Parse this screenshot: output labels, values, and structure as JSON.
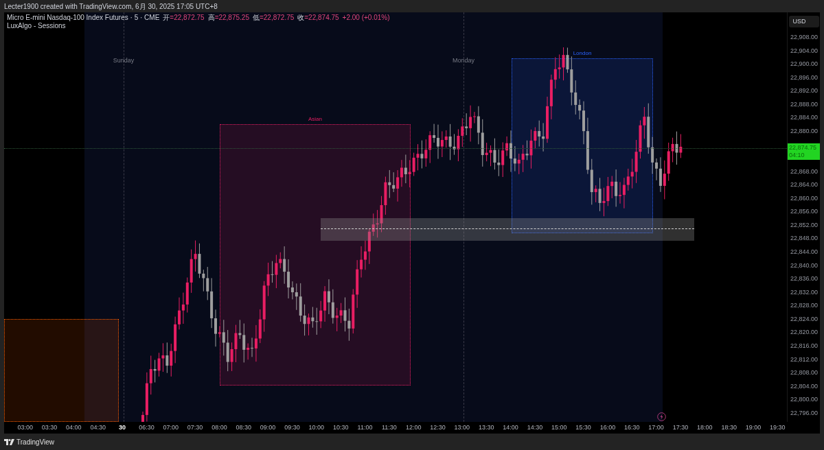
{
  "header": {
    "credit": "Lecter1900 created with TradingView.com, 6月 30, 2025 17:05 UTC+8"
  },
  "legend": {
    "symbol": "Micro E-mini Nasdaq-100 Index Futures · 5 · CME",
    "ohlc": [
      {
        "label": "开",
        "value": "=22,872.75"
      },
      {
        "label": "高",
        "value": "=22,875.25"
      },
      {
        "label": "低",
        "value": "=22,872.75"
      },
      {
        "label": "收",
        "value": "=22,874.75"
      }
    ],
    "change": "+2.00 (+0.01%)",
    "indicator": "LuxAlgo - Sessions"
  },
  "chart": {
    "day_labels": [
      "Sunday",
      "Monday"
    ],
    "sessions": [
      {
        "color": "#ff5d00"
      },
      {
        "label": "Asian",
        "color": "#e91e63"
      },
      {
        "label": "London",
        "color": "#2962ff"
      }
    ]
  },
  "price_axis": {
    "currency": "USD",
    "ticks": [
      {
        "kind": "tick",
        "text": "22,908.00"
      },
      {
        "kind": "tick",
        "text": "22,904.00"
      },
      {
        "kind": "tick",
        "text": "22,900.00"
      },
      {
        "kind": "tick",
        "text": "22,896.00"
      },
      {
        "kind": "tick",
        "text": "22,892.00"
      },
      {
        "kind": "tick",
        "text": "22,888.00"
      },
      {
        "kind": "tick",
        "text": "22,884.00"
      },
      {
        "kind": "tick",
        "text": "22,880.00"
      },
      {
        "kind": "current",
        "text": "22,874.75",
        "countdown": "04:10"
      },
      {
        "kind": "tick",
        "text": "22,868.00"
      },
      {
        "kind": "tick",
        "text": "22,864.00"
      },
      {
        "kind": "tick",
        "text": "22,860.00"
      },
      {
        "kind": "tick",
        "text": "22,856.00"
      },
      {
        "kind": "tick",
        "text": "22,852.00"
      },
      {
        "kind": "tick",
        "text": "22,848.00"
      },
      {
        "kind": "tick",
        "text": "22,844.00"
      },
      {
        "kind": "tick",
        "text": "22,840.00"
      },
      {
        "kind": "tick",
        "text": "22,836.00"
      },
      {
        "kind": "tick",
        "text": "22,832.00"
      },
      {
        "kind": "tick",
        "text": "22,828.00"
      },
      {
        "kind": "tick",
        "text": "22,824.00"
      },
      {
        "kind": "tick",
        "text": "22,820.00"
      },
      {
        "kind": "tick",
        "text": "22,816.00"
      },
      {
        "kind": "tick",
        "text": "22,812.00"
      },
      {
        "kind": "tick",
        "text": "22,808.00"
      },
      {
        "kind": "tick",
        "text": "22,804.00"
      },
      {
        "kind": "tick",
        "text": "22,800.00"
      },
      {
        "kind": "tick",
        "text": "22,796.00"
      }
    ]
  },
  "time_axis": {
    "labels": [
      {
        "text": "03:00",
        "bold": false
      },
      {
        "text": "03:30",
        "bold": false
      },
      {
        "text": "04:00",
        "bold": false
      },
      {
        "text": "04:30",
        "bold": false
      },
      {
        "text": "30",
        "bold": true
      },
      {
        "text": "06:30",
        "bold": false
      },
      {
        "text": "07:00",
        "bold": false
      },
      {
        "text": "07:30",
        "bold": false
      },
      {
        "text": "08:00",
        "bold": false
      },
      {
        "text": "08:30",
        "bold": false
      },
      {
        "text": "09:00",
        "bold": false
      },
      {
        "text": "09:30",
        "bold": false
      },
      {
        "text": "10:00",
        "bold": false
      },
      {
        "text": "10:30",
        "bold": false
      },
      {
        "text": "11:00",
        "bold": false
      },
      {
        "text": "11:30",
        "bold": false
      },
      {
        "text": "12:00",
        "bold": false
      },
      {
        "text": "12:30",
        "bold": false
      },
      {
        "text": "13:00",
        "bold": false
      },
      {
        "text": "13:30",
        "bold": false
      },
      {
        "text": "14:00",
        "bold": false
      },
      {
        "text": "14:30",
        "bold": false
      },
      {
        "text": "15:00",
        "bold": false
      },
      {
        "text": "15:30",
        "bold": false
      },
      {
        "text": "16:00",
        "bold": false
      },
      {
        "text": "16:30",
        "bold": false
      },
      {
        "text": "17:00",
        "bold": false
      },
      {
        "text": "17:30",
        "bold": false
      },
      {
        "text": "18:00",
        "bold": false
      },
      {
        "text": "18:30",
        "bold": false
      },
      {
        "text": "19:00",
        "bold": false
      },
      {
        "text": "19:30",
        "bold": false
      }
    ]
  },
  "footer": {
    "brand": "TradingView"
  }
}
